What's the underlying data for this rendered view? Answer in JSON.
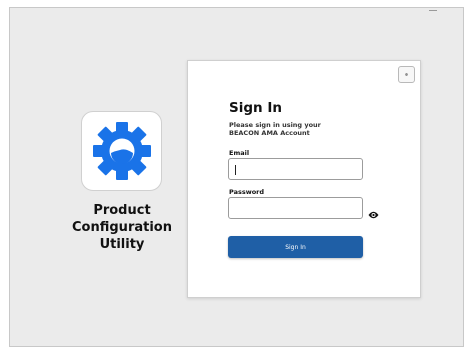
{
  "product": {
    "name_line1": "Product",
    "name_line2": "Configuration",
    "name_line3": "Utility",
    "logo_icon": "gear-icon",
    "logo_color": "#1a73e8"
  },
  "signin": {
    "title": "Sign In",
    "subtitle_line1": "Please sign in using your",
    "subtitle_line2": "BEACON AMA Account",
    "email_label": "Email",
    "email_value": "",
    "password_label": "Password",
    "password_value": "",
    "button_label": "Sign In",
    "button_color": "#1f5fa6",
    "settings_icon": "gear-icon",
    "password_toggle_icon": "eye-icon"
  }
}
